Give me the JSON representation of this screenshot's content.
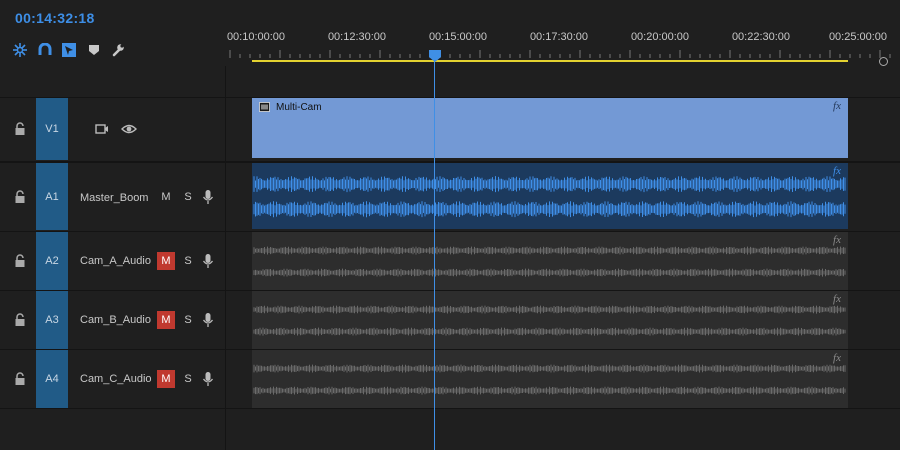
{
  "timecode": "00:14:32:18",
  "toolbar": {
    "tools": [
      "snap-icon",
      "magnet-icon",
      "linked-selection-icon",
      "marker-icon",
      "wrench-icon"
    ]
  },
  "ruler": {
    "labels": [
      "00:10:00:00",
      "00:12:30:00",
      "00:15:00:00",
      "00:17:30:00",
      "00:20:00:00",
      "00:22:30:00",
      "00:25:00:00"
    ]
  },
  "playhead": "00:14:32:18",
  "tracks": {
    "v1": {
      "label": "V1",
      "clip_name": "Multi-Cam",
      "fx": "fx"
    },
    "a1": {
      "label": "A1",
      "name": "Master_Boom",
      "mute": "M",
      "solo": "S",
      "muted": false,
      "fx": "fx"
    },
    "a2": {
      "label": "A2",
      "name": "Cam_A_Audio",
      "mute": "M",
      "solo": "S",
      "muted": true,
      "fx": "fx"
    },
    "a3": {
      "label": "A3",
      "name": "Cam_B_Audio",
      "mute": "M",
      "solo": "S",
      "muted": true,
      "fx": "fx"
    },
    "a4": {
      "label": "A4",
      "name": "Cam_C_Audio",
      "mute": "M",
      "solo": "S",
      "muted": true,
      "fx": "fx"
    }
  },
  "colors": {
    "accent": "#3d8ee6",
    "track_tag": "#215b87",
    "video_clip": "#7399d5",
    "active_audio_clip": "#1c3a5e",
    "active_waveform": "#3f8fe8",
    "muted_audio_clip": "#2d2d2d",
    "muted_waveform": "#6b6b6b",
    "mute_on": "#c0392f",
    "work_area": "#e3d230"
  }
}
